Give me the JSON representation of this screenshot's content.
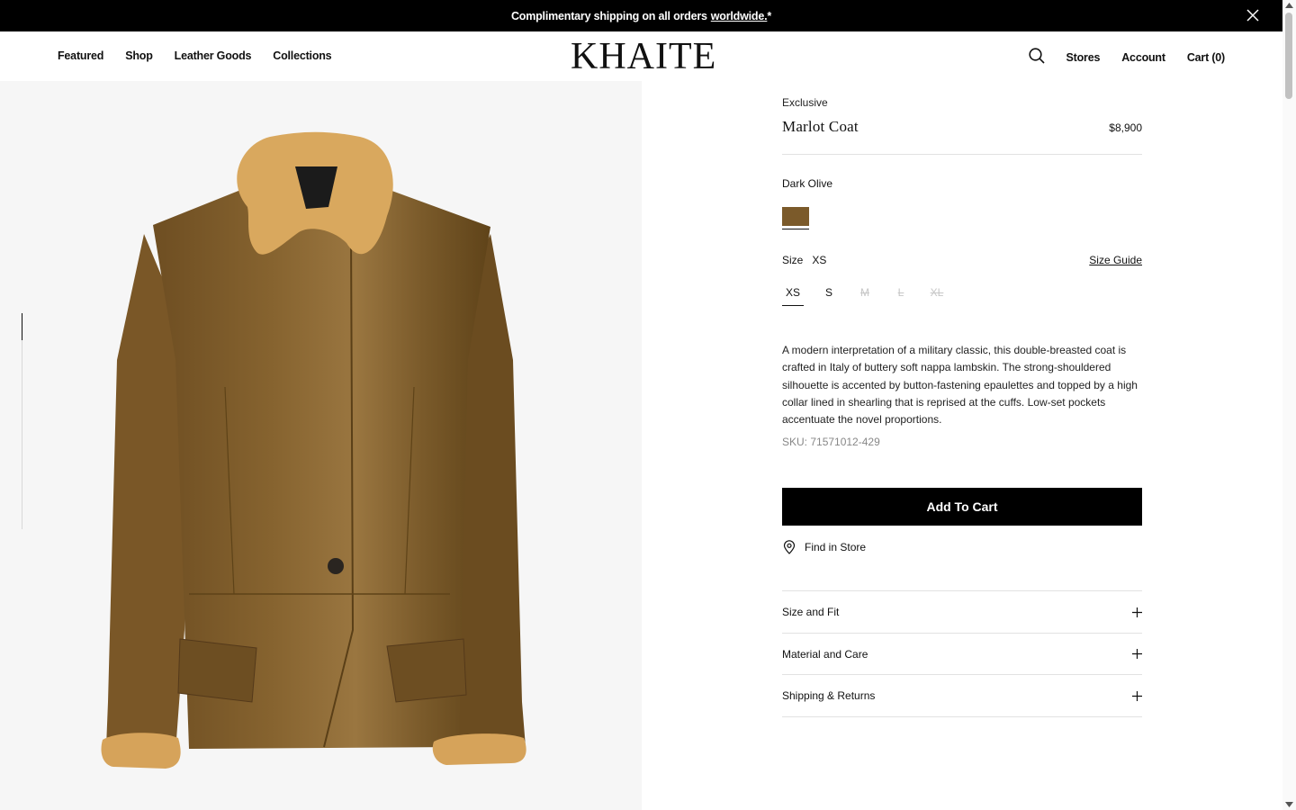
{
  "announcement": {
    "text": "Complimentary shipping on all orders",
    "link": "worldwide.",
    "suffix": "*"
  },
  "header": {
    "nav": [
      "Featured",
      "Shop",
      "Leather Goods",
      "Collections"
    ],
    "logo": "KHAITE",
    "util": {
      "stores": "Stores",
      "account": "Account",
      "cart": "Cart (0)"
    }
  },
  "product": {
    "tag": "Exclusive",
    "name": "Marlot Coat",
    "price": "$8,900",
    "color_name": "Dark Olive",
    "swatch_color": "#7b5a2a",
    "size_label": "Size",
    "selected_size": "XS",
    "size_guide": "Size Guide",
    "sizes": [
      {
        "label": "XS",
        "available": true
      },
      {
        "label": "S",
        "available": true
      },
      {
        "label": "M",
        "available": false
      },
      {
        "label": "L",
        "available": false
      },
      {
        "label": "XL",
        "available": false
      }
    ],
    "description": "A modern interpretation of a military classic, this double-breasted coat is crafted in Italy of buttery soft nappa lambskin. The strong-shouldered silhouette is accented by button-fastening epaulettes and topped by a high collar lined in shearling that is reprised at the cuffs. Low-set pockets accentuate the novel proportions.",
    "sku": "SKU: 71571012-429",
    "add_to_cart": "Add To Cart",
    "find_in_store": "Find in Store",
    "accordions": [
      "Size and Fit",
      "Material and Care",
      "Shipping & Returns"
    ]
  },
  "icons": [
    "close-icon",
    "search-icon",
    "location-pin-icon",
    "plus-icon"
  ]
}
